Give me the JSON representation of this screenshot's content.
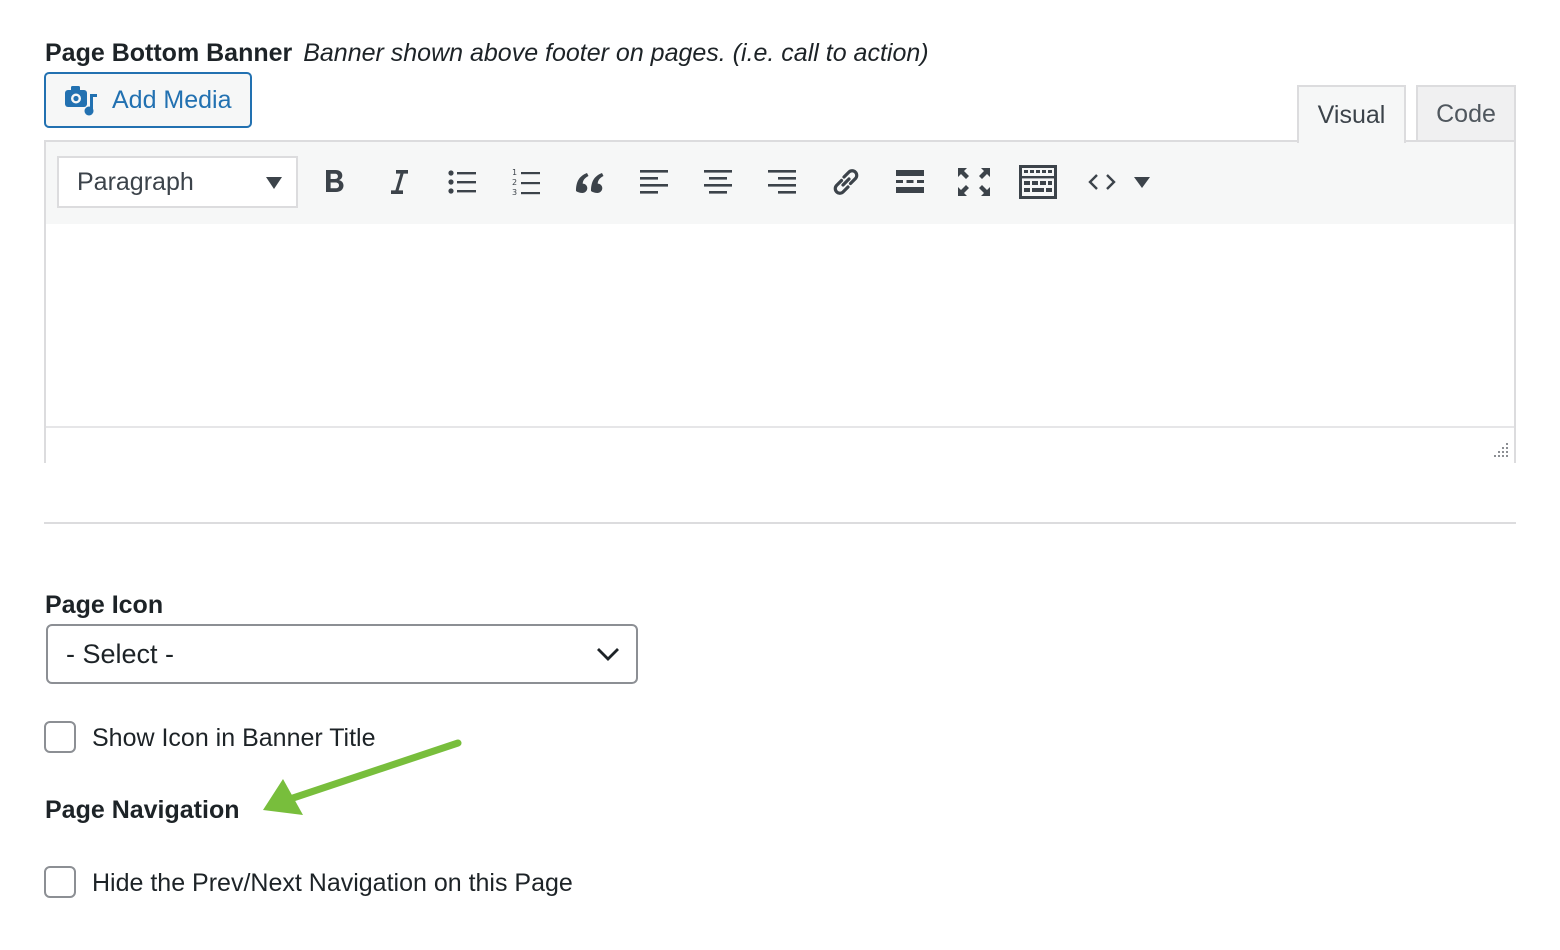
{
  "banner_field": {
    "title": "Page Bottom Banner",
    "description": "Banner shown above footer on pages. (i.e. call to action)"
  },
  "editor": {
    "add_media_label": "Add Media",
    "tabs": [
      {
        "label": "Visual",
        "active": true
      },
      {
        "label": "Code",
        "active": false
      }
    ],
    "format_select_value": "Paragraph",
    "toolbar_icons": [
      "bold-icon",
      "italic-icon",
      "bulleted-list-icon",
      "numbered-list-icon",
      "blockquote-icon",
      "align-left-icon",
      "align-center-icon",
      "align-right-icon",
      "link-icon",
      "read-more-icon",
      "fullscreen-icon",
      "toolbar-toggle-icon",
      "code-icon",
      "more-dropdown-icon"
    ]
  },
  "page_icon": {
    "label": "Page Icon",
    "select_value": "- Select -"
  },
  "show_icon_checkbox": {
    "label": "Show Icon in Banner Title",
    "checked": false
  },
  "page_navigation": {
    "label": "Page Navigation",
    "hide_nav_checkbox": {
      "label": "Hide the Prev/Next Navigation on this Page",
      "checked": false
    }
  },
  "colors": {
    "accent": "#2271b1",
    "annotation_arrow": "#78be3c",
    "border": "#dcdcde"
  }
}
